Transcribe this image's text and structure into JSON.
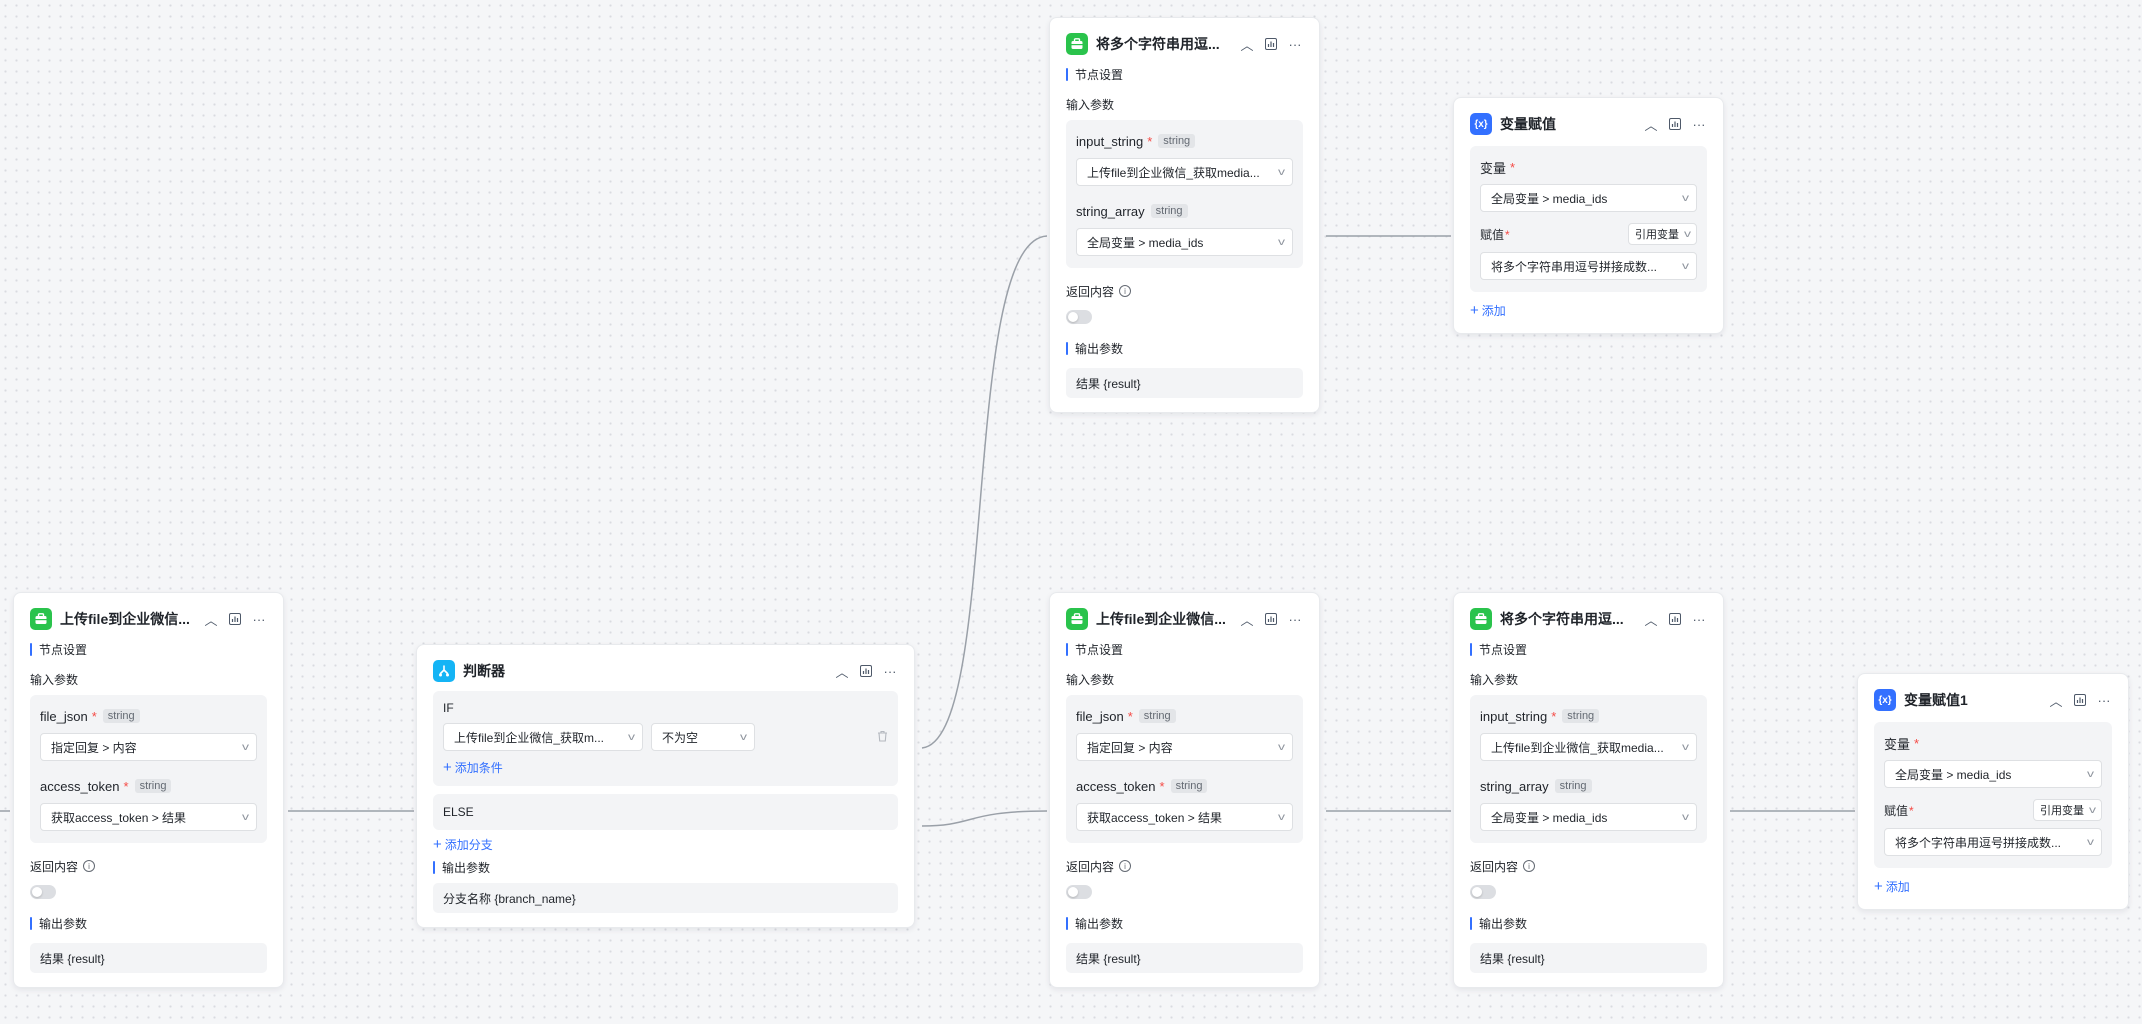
{
  "common": {
    "node_settings": "节点设置",
    "input_params": "输入参数",
    "return_content": "返回内容",
    "output_params": "输出参数",
    "result": "结果 {result}",
    "string_type": "string",
    "required_mark": "*",
    "add": "添加"
  },
  "nodes": {
    "join_top": {
      "title": "将多个字符串用逗...",
      "param1_name": "input_string",
      "param1_value": "上传file到企业微信_获取media...",
      "param2_name": "string_array",
      "param2_value": "全局变量 > media_ids"
    },
    "assign_top": {
      "title": "变量赋值",
      "var_label": "变量",
      "var_value": "全局变量 > media_ids",
      "assign_label": "赋值",
      "ref_select": "引用变量",
      "assign_value": "将多个字符串用逗号拼接成数..."
    },
    "upload_left": {
      "title": "上传file到企业微信...",
      "param1_name": "file_json",
      "param1_value": "指定回复 > 内容",
      "param2_name": "access_token",
      "param2_value": "获取access_token > 结果"
    },
    "judge": {
      "title": "判断器",
      "if_label": "IF",
      "cond_var": "上传file到企业微信_获取m...",
      "cond_op": "不为空",
      "add_condition": "添加条件",
      "else_label": "ELSE",
      "add_branch": "添加分支",
      "output_value": "分支名称 {branch_name}"
    },
    "upload_mid": {
      "title": "上传file到企业微信...",
      "param1_name": "file_json",
      "param1_value": "指定回复 > 内容",
      "param2_name": "access_token",
      "param2_value": "获取access_token > 结果"
    },
    "join_bottom": {
      "title": "将多个字符串用逗...",
      "param1_name": "input_string",
      "param1_value": "上传file到企业微信_获取media...",
      "param2_name": "string_array",
      "param2_value": "全局变量 > media_ids"
    },
    "assign_bottom": {
      "title": "变量赋值1",
      "var_label": "变量",
      "var_value": "全局变量 > media_ids",
      "assign_label": "赋值",
      "ref_select": "引用变量",
      "assign_value": "将多个字符串用逗号拼接成数..."
    }
  },
  "colors": {
    "plugin_icon": "#2ac34c",
    "variable_icon": "#3370ff",
    "judge_icon": "#14b4f5",
    "accent": "#3370ff",
    "required": "#f54a45"
  }
}
